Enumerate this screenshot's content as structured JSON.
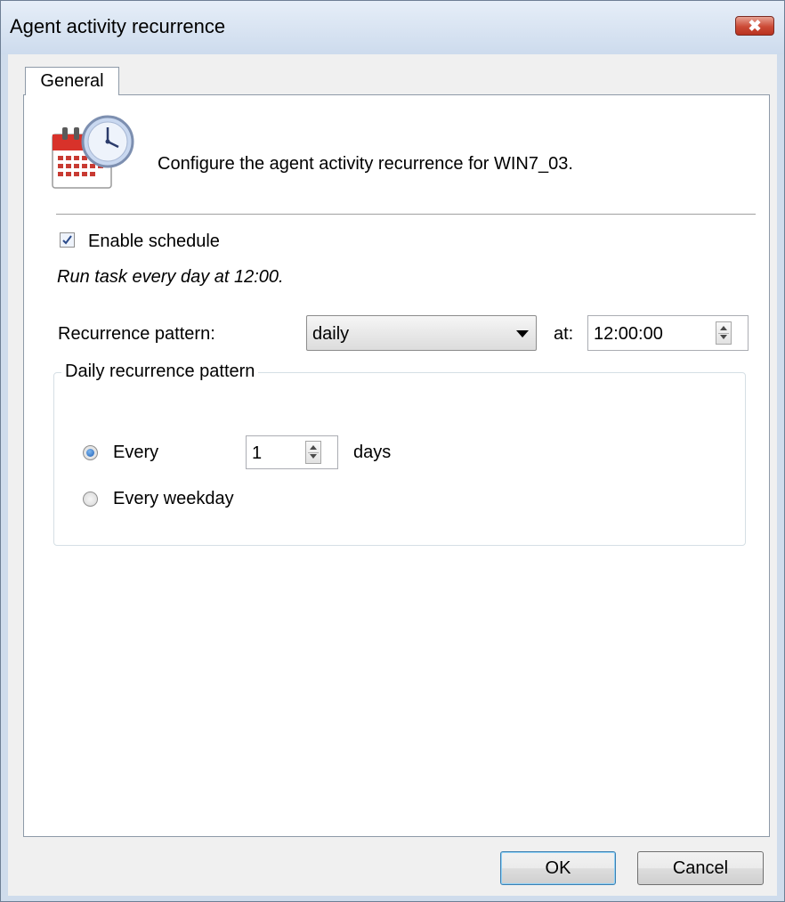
{
  "window": {
    "title": "Agent activity recurrence",
    "close_label": "✖"
  },
  "tabs": [
    {
      "label": "General",
      "selected": true
    }
  ],
  "header": {
    "icon": "calendar-clock-icon",
    "description": "Configure the agent activity recurrence for WIN7_03."
  },
  "schedule": {
    "enable_label": "Enable schedule",
    "enabled": true,
    "summary": "Run task every day at 12:00."
  },
  "recurrence": {
    "pattern_label": "Recurrence pattern:",
    "pattern_value": "daily",
    "at_label": "at:",
    "time_value": "12:00:00"
  },
  "daily_group": {
    "legend": "Daily recurrence pattern",
    "every_label": "Every",
    "every_selected": true,
    "days_value": "1",
    "days_label": "days",
    "weekday_label": "Every weekday",
    "weekday_selected": false
  },
  "buttons": {
    "ok": "OK",
    "cancel": "Cancel"
  },
  "colors": {
    "window_frame": "#cfdcec",
    "client_bg": "#f0f0f0",
    "close_button": "#cc4a36",
    "radio_selected": "#1f5fb5"
  }
}
